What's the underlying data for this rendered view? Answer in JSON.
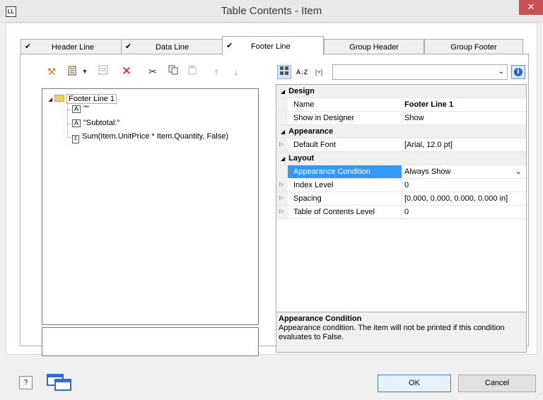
{
  "window": {
    "title": "Table Contents - Item",
    "app_icon": "LL",
    "close_glyph": "✕"
  },
  "tabs": [
    {
      "label": "Header Line",
      "checked": true
    },
    {
      "label": "Data Line",
      "checked": true
    },
    {
      "label": "Footer Line",
      "checked": true,
      "active": true
    },
    {
      "label": "Group Header",
      "checked": false
    },
    {
      "label": "Group Footer",
      "checked": false
    }
  ],
  "check_glyph": "✔",
  "tree_toolbar": {
    "icons": [
      "magic-wand-icon",
      "insert-icon",
      "dropdown-arrow-icon",
      "properties-icon",
      "delete-icon",
      "cut-icon",
      "copy-icon",
      "paste-icon",
      "move-up-icon",
      "move-down-icon"
    ]
  },
  "tree": {
    "root": "Footer Line 1",
    "items": [
      {
        "icon": "text-icon",
        "label": "\"\""
      },
      {
        "icon": "text-icon",
        "label": "\"Subtotal:\""
      },
      {
        "icon": "sum-icon",
        "label": "Sum(Item.UnitPrice * Item.Quantity, False)"
      }
    ]
  },
  "prop_toolbar": {
    "sort_label": "A↓Z",
    "bracket_label": "[+]",
    "combo_value": ""
  },
  "properties": {
    "categories": [
      {
        "label": "Design",
        "rows": [
          {
            "name": "Name",
            "value": "Footer Line 1",
            "bold": true
          },
          {
            "name": "Show in Designer",
            "value": "Show"
          }
        ]
      },
      {
        "label": "Appearance",
        "rows": [
          {
            "name": "Default Font",
            "value": "[Arial, 12.0 pt]",
            "expandable": true
          }
        ]
      },
      {
        "label": "Layout",
        "rows": [
          {
            "name": "Appearance Condition",
            "value": "Always Show",
            "selected": true
          },
          {
            "name": "Index Level",
            "value": "0",
            "expandable": true
          },
          {
            "name": "Spacing",
            "value": "[0.000, 0.000, 0.000, 0.000 in]",
            "expandable": true
          },
          {
            "name": "Table of Contents Level",
            "value": "0",
            "expandable": true
          }
        ]
      }
    ]
  },
  "description": {
    "title": "Appearance Condition",
    "text": "Appearance condition. The item will not be printed if this condition evaluates to False."
  },
  "footer": {
    "help": "?",
    "ok": "OK",
    "cancel": "Cancel"
  },
  "colors": {
    "selection": "#3399ff",
    "close": "#c75050",
    "delete": "#d42020",
    "info": "#2a67c7"
  }
}
